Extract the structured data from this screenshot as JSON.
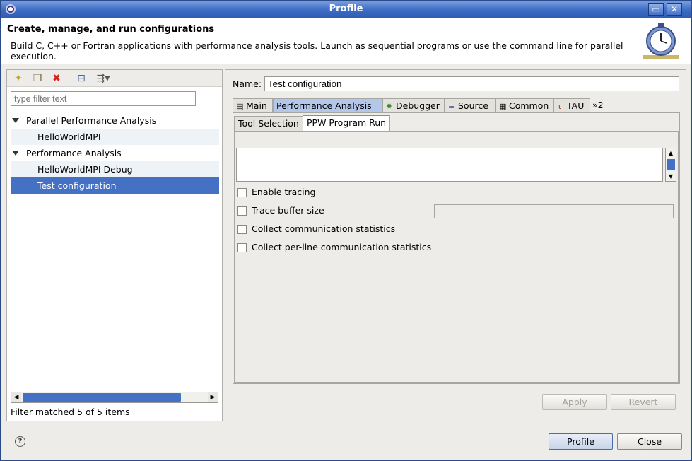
{
  "window": {
    "title": "Profile"
  },
  "header": {
    "title": "Create, manage, and run configurations",
    "description": "Build C, C++ or Fortran applications with performance analysis tools.  Launch as sequential programs or use the command line for parallel execution."
  },
  "left": {
    "toolbar": [
      "new-config-icon",
      "duplicate-icon",
      "delete-icon",
      "collapse-all-icon",
      "filter-icon"
    ],
    "filter_placeholder": "type filter text",
    "tree": [
      {
        "label": "Parallel Performance Analysis",
        "type": "category"
      },
      {
        "label": "HelloWorldMPI",
        "type": "leaf"
      },
      {
        "label": "Performance Analysis",
        "type": "category"
      },
      {
        "label": "HelloWorldMPI Debug",
        "type": "leaf"
      },
      {
        "label": "Test configuration",
        "type": "leaf",
        "selected": true
      }
    ],
    "status": "Filter matched 5 of 5 items"
  },
  "right": {
    "name_label": "Name:",
    "name_value": "Test configuration",
    "tabs": [
      "Main",
      "Performance Analysis",
      "Debugger",
      "Source",
      "Common",
      "TAU",
      "»2"
    ],
    "active_tab": "Performance Analysis",
    "subtabs": [
      "Tool Selection",
      "PPW Program Run"
    ],
    "active_subtab": "PPW Program Run",
    "checkboxes": [
      "Enable tracing",
      "Trace buffer size",
      "Collect communication statistics",
      "Collect per-line communication statistics"
    ],
    "apply": "Apply",
    "revert": "Revert"
  },
  "footer": {
    "profile": "Profile",
    "close": "Close"
  },
  "colors": {
    "titlebar": "#3d6cc4",
    "selection": "#4571c4",
    "active_tab": "#b3c7ea"
  }
}
